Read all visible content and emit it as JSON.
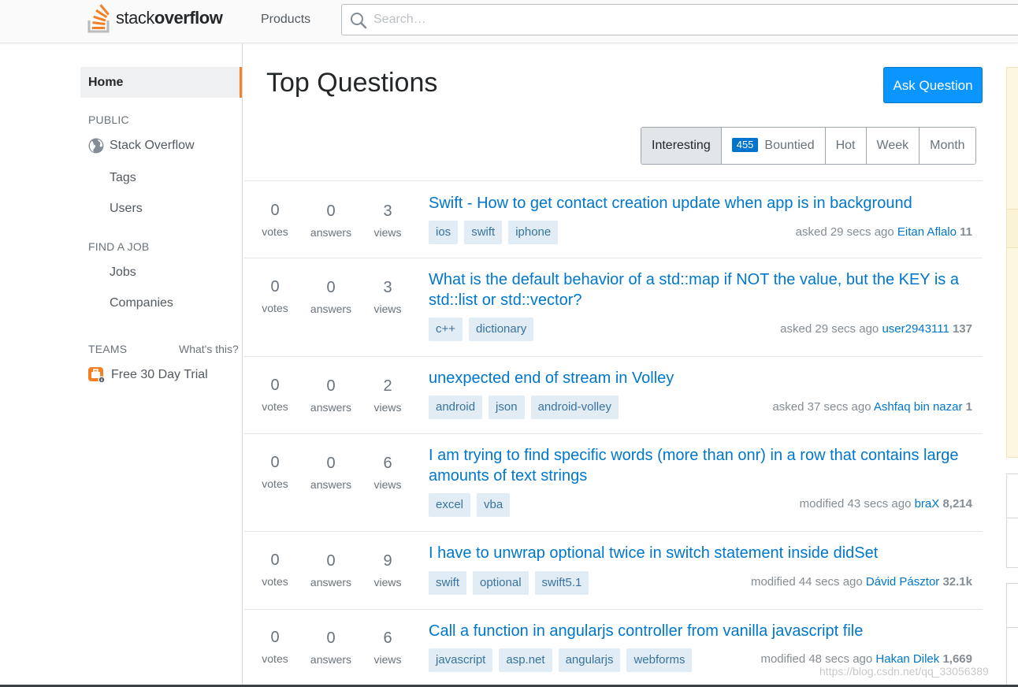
{
  "header": {
    "logo_light": "stack",
    "logo_bold": "overflow",
    "products": "Products",
    "search_placeholder": "Search…"
  },
  "sidebar": {
    "home": "Home",
    "public_label": "PUBLIC",
    "stack_overflow": "Stack Overflow",
    "tags": "Tags",
    "users": "Users",
    "find_job_label": "FIND A JOB",
    "jobs": "Jobs",
    "companies": "Companies",
    "teams_label": "TEAMS",
    "whats_this": "What's this?",
    "trial": "Free 30 Day Trial"
  },
  "main": {
    "title": "Top Questions",
    "ask_button": "Ask Question",
    "filters": {
      "interesting": "Interesting",
      "bountied_count": "455",
      "bountied": "Bountied",
      "hot": "Hot",
      "week": "Week",
      "month": "Month"
    }
  },
  "labels": {
    "votes": "votes",
    "answers": "answers",
    "views": "views"
  },
  "questions": [
    {
      "votes": "0",
      "answers": "0",
      "views": "3",
      "title": "Swift - How to get contact creation update when app is in background",
      "tags": [
        "ios",
        "swift",
        "iphone"
      ],
      "action": "asked 29 secs ago",
      "user": "Eitan Aflalo",
      "rep": "11"
    },
    {
      "votes": "0",
      "answers": "0",
      "views": "3",
      "title": "What is the default behavior of a std::map if NOT the value, but the KEY is a std::list or std::vector?",
      "tags": [
        "c++",
        "dictionary"
      ],
      "action": "asked 29 secs ago",
      "user": "user2943111",
      "rep": "137"
    },
    {
      "votes": "0",
      "answers": "0",
      "views": "2",
      "title": "unexpected end of stream in Volley",
      "tags": [
        "android",
        "json",
        "android-volley"
      ],
      "action": "asked 37 secs ago",
      "user": "Ashfaq bin nazar",
      "rep": "1"
    },
    {
      "votes": "0",
      "answers": "0",
      "views": "6",
      "title": "I am trying to find specific words (more than onr) in a row that contains large amounts of text strings",
      "tags": [
        "excel",
        "vba"
      ],
      "action": "modified 43 secs ago",
      "user": "braX",
      "rep": "8,214"
    },
    {
      "votes": "0",
      "answers": "0",
      "views": "9",
      "title": "I have to unwrap optional twice in switch statement inside didSet",
      "tags": [
        "swift",
        "optional",
        "swift5.1"
      ],
      "action": "modified 44 secs ago",
      "user": "Dávid Pásztor",
      "rep": "32.1k"
    },
    {
      "votes": "0",
      "answers": "0",
      "views": "6",
      "title": "Call a function in angularjs controller from vanilla javascript file",
      "tags": [
        "javascript",
        "asp.net",
        "angularjs",
        "webforms"
      ],
      "action": "modified 48 secs ago",
      "user": "Hakan Dilek",
      "rep": "1,669"
    }
  ],
  "watermark": "https://blog.csdn.net/qq_33056389",
  "colors": {
    "accent": "#f48024",
    "link": "#0077cc",
    "button": "#0a95ff",
    "tag_bg": "#e1ecf4",
    "tag_text": "#39739d"
  }
}
